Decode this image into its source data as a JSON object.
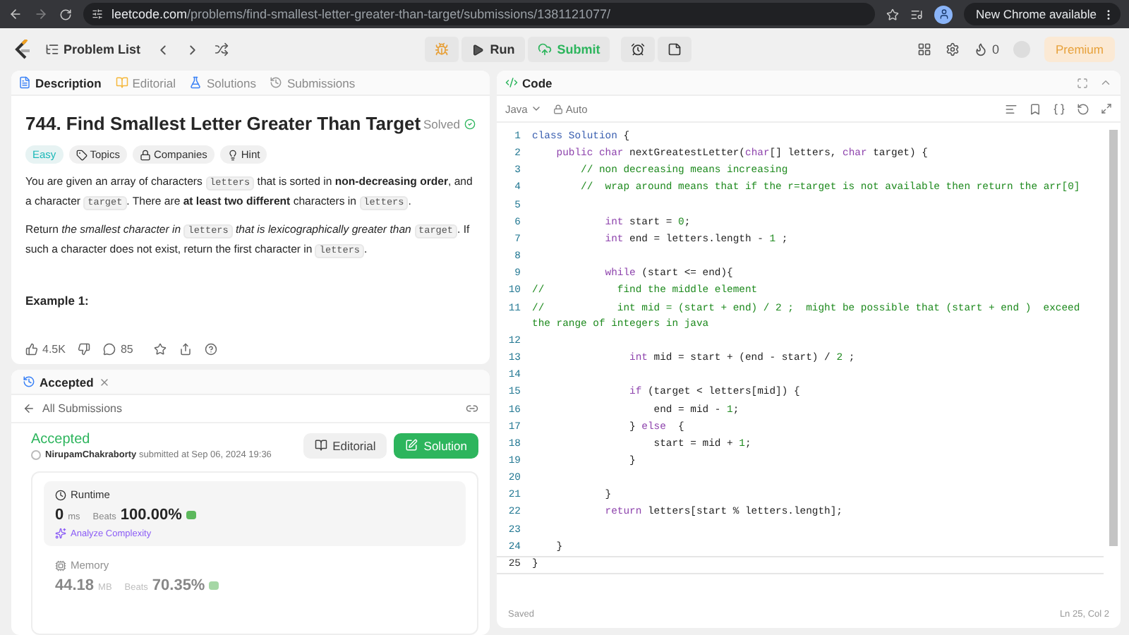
{
  "browser": {
    "url_host": "leetcode.com",
    "url_path": "/problems/find-smallest-letter-greater-than-target/submissions/1381121077/",
    "update_label": "New Chrome available"
  },
  "nav": {
    "problem_list": "Problem List",
    "run": "Run",
    "submit": "Submit",
    "coins": "0",
    "premium": "Premium"
  },
  "description": {
    "tabs": [
      {
        "label": "Description",
        "selected": true
      },
      {
        "label": "Editorial",
        "selected": false
      },
      {
        "label": "Solutions",
        "selected": false
      },
      {
        "label": "Submissions",
        "selected": false
      }
    ],
    "title": "744. Find Smallest Letter Greater Than Target",
    "status": "Solved",
    "tags": [
      {
        "label": "Easy",
        "kind": "difficulty"
      },
      {
        "label": "Topics",
        "kind": "topics"
      },
      {
        "label": "Companies",
        "kind": "companies"
      },
      {
        "label": "Hint",
        "kind": "hint"
      }
    ],
    "paragraphs": [
      [
        {
          "kind": "plain",
          "text": "You are given an array of characters "
        },
        {
          "kind": "code",
          "text": "letters"
        },
        {
          "kind": "plain",
          "text": " that is sorted in "
        },
        {
          "kind": "bold",
          "text": "non-decreasing order"
        },
        {
          "kind": "plain",
          "text": ", and a character "
        },
        {
          "kind": "code",
          "text": "target"
        },
        {
          "kind": "plain",
          "text": ". There are "
        },
        {
          "kind": "bold",
          "text": "at least two different"
        },
        {
          "kind": "plain",
          "text": " characters in "
        },
        {
          "kind": "code",
          "text": "letters"
        },
        {
          "kind": "plain",
          "text": "."
        }
      ],
      [
        {
          "kind": "plain",
          "text": "Return "
        },
        {
          "kind": "italic",
          "text": "the smallest character in "
        },
        {
          "kind": "code",
          "text": "letters"
        },
        {
          "kind": "italic",
          "text": " that is lexicographically greater than "
        },
        {
          "kind": "code",
          "text": "target"
        },
        {
          "kind": "plain",
          "text": ". If such a character does not exist, return the first character in "
        },
        {
          "kind": "code",
          "text": "letters"
        },
        {
          "kind": "plain",
          "text": "."
        }
      ]
    ],
    "example_heading": "Example 1:",
    "likes": "4.5K",
    "comments": "85"
  },
  "submission": {
    "tab": "Accepted",
    "back_link": "All Submissions",
    "status": "Accepted",
    "user": "NirupamChakraborty",
    "submitted_text": "submitted at Sep 06, 2024 19:36",
    "buttons": [
      {
        "label": "Editorial",
        "kind": "secondary"
      },
      {
        "label": "Solution",
        "kind": "primary"
      }
    ],
    "metrics": [
      {
        "label": "Runtime",
        "value": "0",
        "unit": "ms",
        "beats_label": "Beats",
        "beats_value": "100.00%",
        "analyze": "Analyze Complexity",
        "selected": true
      },
      {
        "label": "Memory",
        "value": "44.18",
        "unit": "MB",
        "beats_label": "Beats",
        "beats_value": "70.35%",
        "selected": false
      }
    ]
  },
  "editor": {
    "title": "Code",
    "language": "Java",
    "mode": "Auto",
    "status_left": "Saved",
    "status_right": "Ln 25, Col 2",
    "lines": [
      {
        "number": "1",
        "current": false,
        "tokens": [
          {
            "kind": "type",
            "text": "class"
          },
          {
            "kind": "type",
            "text": " Solution"
          },
          {
            "kind": "plain",
            "text": " {"
          }
        ]
      },
      {
        "number": "2",
        "current": false,
        "tokens": [
          {
            "kind": "keyword",
            "text": "    public"
          },
          {
            "kind": "keyword",
            "text": " char"
          },
          {
            "kind": "plain",
            "text": " nextGreatestLetter("
          },
          {
            "kind": "keyword",
            "text": "char"
          },
          {
            "kind": "plain",
            "text": "[] letters, "
          },
          {
            "kind": "keyword",
            "text": "char"
          },
          {
            "kind": "plain",
            "text": " target) {"
          }
        ]
      },
      {
        "number": "3",
        "current": false,
        "tokens": [
          {
            "kind": "comment",
            "text": "        // non decreasing means increasing"
          }
        ]
      },
      {
        "number": "4",
        "current": false,
        "tokens": [
          {
            "kind": "comment",
            "text": "        //  wrap around means that if the r=target is not available then return the arr[0]"
          }
        ]
      },
      {
        "number": "5",
        "current": false
      },
      {
        "number": "6",
        "current": false,
        "tokens": [
          {
            "kind": "keyword",
            "text": "            int"
          },
          {
            "kind": "plain",
            "text": " start = "
          },
          {
            "kind": "number",
            "text": "0"
          },
          {
            "kind": "plain",
            "text": ";"
          }
        ]
      },
      {
        "number": "7",
        "current": false,
        "tokens": [
          {
            "kind": "keyword",
            "text": "            int"
          },
          {
            "kind": "plain",
            "text": " end = letters.length - "
          },
          {
            "kind": "number",
            "text": "1"
          },
          {
            "kind": "plain",
            "text": " ;"
          }
        ]
      },
      {
        "number": "8",
        "current": false
      },
      {
        "number": "9",
        "current": false,
        "tokens": [
          {
            "kind": "keyword",
            "text": "            while"
          },
          {
            "kind": "plain",
            "text": " (start <= end){"
          }
        ]
      },
      {
        "number": "10",
        "current": false,
        "tokens": [
          {
            "kind": "comment",
            "text": "//            find the middle element"
          }
        ]
      },
      {
        "number": "11",
        "current": false,
        "tokens": [
          {
            "kind": "comment",
            "text": "//            int mid = (start + end) / 2 ;  might be possible that (start + end )  exceed the range of integers in java"
          }
        ]
      },
      {
        "number": "12",
        "current": false
      },
      {
        "number": "13",
        "current": false,
        "tokens": [
          {
            "kind": "keyword",
            "text": "                int"
          },
          {
            "kind": "plain",
            "text": " mid = start + (end - start) / "
          },
          {
            "kind": "number",
            "text": "2"
          },
          {
            "kind": "plain",
            "text": " ;"
          }
        ]
      },
      {
        "number": "14",
        "current": false
      },
      {
        "number": "15",
        "current": false,
        "tokens": [
          {
            "kind": "keyword",
            "text": "                if"
          },
          {
            "kind": "plain",
            "text": " (target < letters[mid]) {"
          }
        ]
      },
      {
        "number": "16",
        "current": false,
        "tokens": [
          {
            "kind": "plain",
            "text": "                    end = mid - "
          },
          {
            "kind": "number",
            "text": "1"
          },
          {
            "kind": "plain",
            "text": ";"
          }
        ]
      },
      {
        "number": "17",
        "current": false,
        "tokens": [
          {
            "kind": "plain",
            "text": "                } "
          },
          {
            "kind": "keyword",
            "text": "else"
          },
          {
            "kind": "plain",
            "text": "  {"
          }
        ]
      },
      {
        "number": "18",
        "current": false,
        "tokens": [
          {
            "kind": "plain",
            "text": "                    start = mid + "
          },
          {
            "kind": "number",
            "text": "1"
          },
          {
            "kind": "plain",
            "text": ";"
          }
        ]
      },
      {
        "number": "19",
        "current": false,
        "tokens": [
          {
            "kind": "plain",
            "text": "                }"
          }
        ]
      },
      {
        "number": "20",
        "current": false
      },
      {
        "number": "21",
        "current": false,
        "tokens": [
          {
            "kind": "plain",
            "text": "            }"
          }
        ]
      },
      {
        "number": "22",
        "current": false,
        "tokens": [
          {
            "kind": "keyword",
            "text": "            return"
          },
          {
            "kind": "plain",
            "text": " letters[start % letters.length];"
          }
        ]
      },
      {
        "number": "23",
        "current": false
      },
      {
        "number": "24",
        "current": false,
        "tokens": [
          {
            "kind": "plain",
            "text": "    }"
          }
        ]
      },
      {
        "number": "25",
        "current": true,
        "tokens": [
          {
            "kind": "plain",
            "text": "}"
          }
        ]
      }
    ]
  }
}
